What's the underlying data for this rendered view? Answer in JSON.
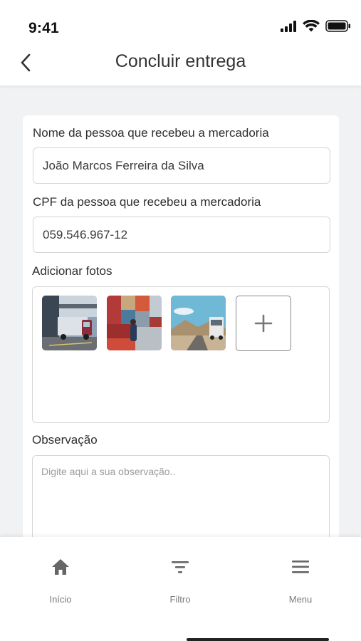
{
  "status_bar": {
    "time": "9:41"
  },
  "header": {
    "title": "Concluir entrega"
  },
  "form": {
    "name_label": "Nome da pessoa que recebeu a mercadoria",
    "name_value": "João Marcos Ferreira da Silva",
    "cpf_label": "CPF da pessoa que recebeu a mercadoria",
    "cpf_value": "059.546.967-12",
    "photos_label": "Adicionar fotos",
    "observation_label": "Observação",
    "observation_placeholder": "Digite aqui a sua observação.."
  },
  "tabbar": {
    "items": [
      {
        "label": "Início",
        "icon": "home-icon"
      },
      {
        "label": "Filtro",
        "icon": "filter-icon"
      },
      {
        "label": "Menu",
        "icon": "menu-icon"
      }
    ]
  },
  "colors": {
    "background": "#f1f2f4",
    "card": "#ffffff",
    "border": "#d6d6d6",
    "icon": "#666666"
  }
}
